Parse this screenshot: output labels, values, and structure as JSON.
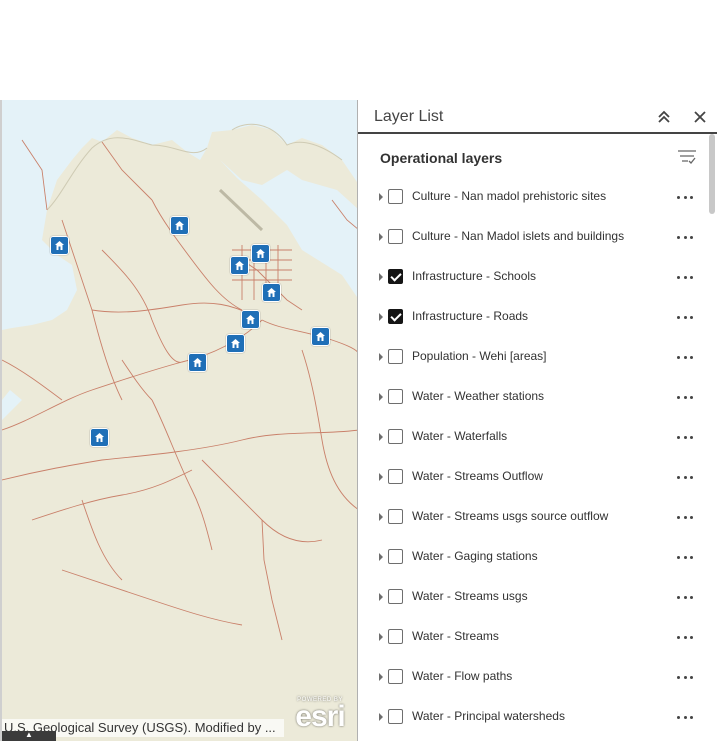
{
  "map": {
    "attribution": "U.S. Geological Survey (USGS). Modified by ...",
    "attribution_toggle_icon": "caret-up-icon",
    "logo": {
      "powered": "POWERED BY",
      "word": "esri"
    },
    "marker_icon": "school-icon",
    "colors": {
      "land": "#ecead9",
      "water": "#e4f2f8",
      "roads": "#c9806a",
      "marker": "#1f6fb7"
    }
  },
  "panel": {
    "title": "Layer List",
    "collapse_icon": "chevron-double-up-icon",
    "close_icon": "close-icon",
    "section_title": "Operational layers",
    "filter_icon": "filter-list-icon",
    "layers": [
      {
        "label": "Culture - Nan madol prehistoric sites",
        "checked": false
      },
      {
        "label": "Culture - Nan Madol islets and buildings",
        "checked": false
      },
      {
        "label": "Infrastructure - Schools",
        "checked": true
      },
      {
        "label": "Infrastructure - Roads",
        "checked": true
      },
      {
        "label": "Population - Wehi [areas]",
        "checked": false
      },
      {
        "label": "Water - Weather stations",
        "checked": false
      },
      {
        "label": "Water - Waterfalls",
        "checked": false
      },
      {
        "label": "Water - Streams Outflow",
        "checked": false
      },
      {
        "label": "Water - Streams usgs source outflow",
        "checked": false
      },
      {
        "label": "Water - Gaging stations",
        "checked": false
      },
      {
        "label": "Water - Streams usgs",
        "checked": false
      },
      {
        "label": "Water - Streams",
        "checked": false
      },
      {
        "label": "Water - Flow paths",
        "checked": false
      },
      {
        "label": "Water - Principal watersheds",
        "checked": false
      }
    ]
  }
}
